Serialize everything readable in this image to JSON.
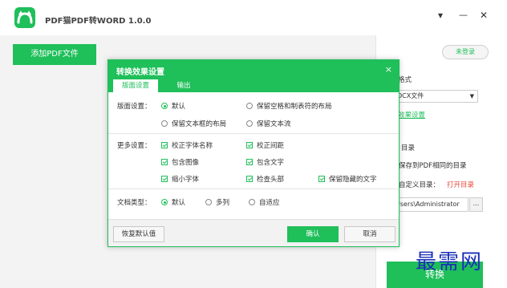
{
  "app": {
    "title": "PDF猫PDF转WORD 1.0.0",
    "brand_color": "#1fbf5a",
    "minimize_glyph": "▾",
    "close_glyph": "✕"
  },
  "toolbar": {
    "add_label": "添加PDF文件",
    "login_label": "未登录"
  },
  "right_panel": {
    "format_label": "格式",
    "format_value": "DCX文件",
    "effect_link": "效果设置",
    "dir_label": "目录",
    "save_same_label": "保存到PDF相同的目录",
    "custom_label": "自定义目录：",
    "open_dir_link": "打开目录",
    "path_value": "Users\\Administrator",
    "browse_label": "...",
    "convert_label": "转换"
  },
  "watermark": "最需网",
  "dialog": {
    "title": "转换效果设置",
    "close_glyph": "×",
    "tabs": [
      {
        "label": "版面设置",
        "active": true
      },
      {
        "label": "输出",
        "active": false
      }
    ],
    "layout": {
      "label": "版面设置：",
      "options": [
        {
          "label": "默认",
          "selected": true
        },
        {
          "label": "保留空格和制表符的布局",
          "selected": false
        },
        {
          "label": "保留文本框的布局",
          "selected": false
        },
        {
          "label": "保留文本流",
          "selected": false
        }
      ]
    },
    "more": {
      "label": "更多设置：",
      "options": [
        {
          "label": "校正字体名称",
          "checked": true
        },
        {
          "label": "校正间距",
          "checked": true
        },
        {
          "label": "包含图像",
          "checked": true
        },
        {
          "label": "包含文字",
          "checked": true
        },
        {
          "label": "缩小字体",
          "checked": true
        },
        {
          "label": "检查头部",
          "checked": true
        },
        {
          "label": "保留隐藏的文字",
          "checked": true
        }
      ]
    },
    "doc_type": {
      "label": "文档类型：",
      "options": [
        {
          "label": "默认",
          "selected": true
        },
        {
          "label": "多列",
          "selected": false
        },
        {
          "label": "自适应",
          "selected": false
        }
      ]
    },
    "footer": {
      "restore_label": "恢复默认值",
      "ok_label": "确认",
      "cancel_label": "取消"
    }
  }
}
